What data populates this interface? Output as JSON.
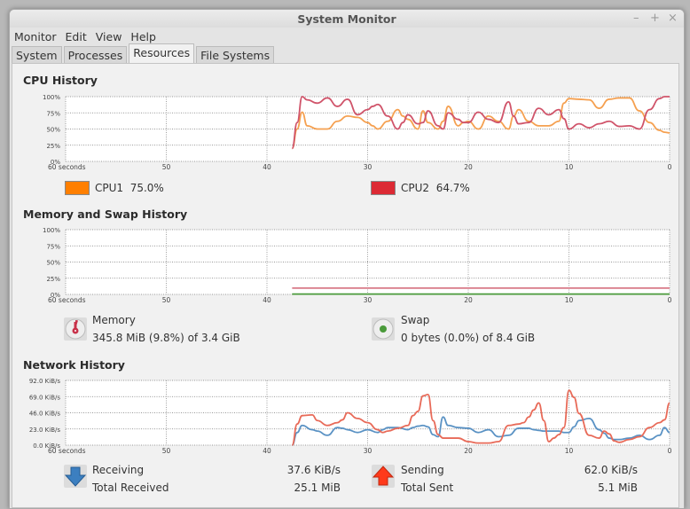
{
  "window": {
    "title": "System Monitor",
    "controls": {
      "minimize": "–",
      "maximize": "+",
      "close": "×"
    }
  },
  "menubar": {
    "items": [
      "Monitor",
      "Edit",
      "View",
      "Help"
    ]
  },
  "tabs": [
    {
      "label": "System",
      "active": false
    },
    {
      "label": "Processes",
      "active": false
    },
    {
      "label": "Resources",
      "active": true
    },
    {
      "label": "File Systems",
      "active": false
    }
  ],
  "cpu": {
    "title": "CPU History",
    "legend": [
      {
        "name": "CPU1",
        "value": "75.0%",
        "color": "#ff7f00"
      },
      {
        "name": "CPU2",
        "value": "64.7%",
        "color": "#dc2a34"
      }
    ]
  },
  "memory": {
    "title": "Memory and Swap History",
    "memory_label": "Memory",
    "memory_value": "345.8 MiB (9.8%) of 3.4 GiB",
    "swap_label": "Swap",
    "swap_value": "0 bytes (0.0%) of 8.4 GiB",
    "memory_color": "#c8324a",
    "swap_color": "#4a9a3a"
  },
  "network": {
    "title": "Network History",
    "receiving_label": "Receiving",
    "receiving_value": "37.6 KiB/s",
    "total_received_label": "Total Received",
    "total_received_value": "25.1 MiB",
    "sending_label": "Sending",
    "sending_value": "62.0 KiB/s",
    "total_sent_label": "Total Sent",
    "total_sent_value": "5.1 MiB",
    "receiving_color": "#3c7fc0",
    "sending_color": "#e04a32"
  },
  "chart_data": [
    {
      "type": "line",
      "title": "CPU History",
      "xlabel": "seconds",
      "x_ticks": [
        "60 seconds",
        "50",
        "40",
        "30",
        "20",
        "10",
        "0"
      ],
      "y_ticks": [
        "100%",
        "75%",
        "50%",
        "25%",
        "0%"
      ],
      "xlim": [
        60,
        0
      ],
      "ylim": [
        0,
        100
      ],
      "grid": true,
      "x": [
        37.5,
        37,
        36.5,
        36,
        35,
        34,
        33,
        32,
        31,
        30,
        29.5,
        29,
        28,
        27,
        26.5,
        26,
        25,
        24.5,
        24,
        23,
        22.5,
        22,
        21,
        20.5,
        20,
        19,
        18,
        17,
        16,
        15.5,
        15,
        14,
        13,
        12,
        11,
        10.5,
        10,
        9,
        8,
        7,
        6,
        5,
        4,
        3,
        2,
        1,
        0.5,
        0
      ],
      "series": [
        {
          "name": "CPU1",
          "color": "#f5a050",
          "values": [
            20,
            50,
            76,
            55,
            50,
            50,
            62,
            70,
            68,
            60,
            55,
            50,
            62,
            80,
            70,
            65,
            50,
            78,
            60,
            50,
            62,
            85,
            55,
            60,
            62,
            50,
            70,
            62,
            50,
            70,
            80,
            62,
            55,
            55,
            62,
            90,
            97,
            96,
            95,
            82,
            96,
            98,
            98,
            78,
            60,
            48,
            45,
            44
          ]
        },
        {
          "name": "CPU2",
          "color": "#d0546a",
          "values": [
            20,
            60,
            100,
            95,
            90,
            98,
            85,
            96,
            72,
            80,
            85,
            88,
            70,
            50,
            60,
            72,
            58,
            60,
            78,
            55,
            50,
            75,
            65,
            60,
            60,
            76,
            65,
            60,
            92,
            70,
            58,
            60,
            82,
            72,
            80,
            66,
            50,
            58,
            52,
            58,
            62,
            54,
            55,
            50,
            80,
            97,
            100,
            100
          ]
        }
      ]
    },
    {
      "type": "line",
      "title": "Memory and Swap History",
      "xlabel": "seconds",
      "x_ticks": [
        "60 seconds",
        "50",
        "40",
        "30",
        "20",
        "10",
        "0"
      ],
      "y_ticks": [
        "100%",
        "75%",
        "50%",
        "25%",
        "0%"
      ],
      "xlim": [
        60,
        0
      ],
      "ylim": [
        0,
        100
      ],
      "grid": true,
      "x": [
        37.5,
        0
      ],
      "series": [
        {
          "name": "Memory",
          "color": "#d87a88",
          "values": [
            9.8,
            9.8
          ]
        },
        {
          "name": "Swap",
          "color": "#4a9a3a",
          "values": [
            0.5,
            0.5
          ]
        }
      ]
    },
    {
      "type": "line",
      "title": "Network History",
      "xlabel": "seconds",
      "x_ticks": [
        "60 seconds",
        "50",
        "40",
        "30",
        "20",
        "10",
        "0"
      ],
      "y_ticks": [
        "92.0 KiB/s",
        "69.0 KiB/s",
        "46.0 KiB/s",
        "23.0 KiB/s",
        "0.0 KiB/s"
      ],
      "xlim": [
        60,
        0
      ],
      "ylim": [
        0,
        92
      ],
      "grid": true,
      "x": [
        37.5,
        37,
        36.5,
        35.5,
        35,
        34,
        33,
        32.5,
        32,
        31,
        30,
        29,
        28.5,
        28,
        27,
        26,
        25.5,
        25,
        24.5,
        24,
        23.5,
        23,
        22.5,
        22,
        21,
        20,
        19,
        18,
        17,
        16,
        15,
        14.5,
        14,
        13.5,
        13,
        12.5,
        12,
        11.5,
        11,
        10.5,
        10,
        9.5,
        9,
        8,
        7,
        6.5,
        6,
        5.5,
        5,
        4,
        3,
        2,
        1,
        0.5,
        0
      ],
      "series": [
        {
          "name": "Receiving",
          "color": "#5a92c4",
          "values": [
            0,
            18,
            28,
            22,
            20,
            14,
            25,
            24,
            22,
            18,
            22,
            18,
            22,
            25,
            25,
            22,
            25,
            27,
            28,
            26,
            15,
            12,
            40,
            28,
            25,
            24,
            18,
            22,
            12,
            14,
            24,
            24,
            24,
            22,
            21,
            20,
            20,
            20,
            20,
            18,
            18,
            26,
            35,
            38,
            22,
            17,
            10,
            8,
            8,
            10,
            14,
            8,
            14,
            25,
            18
          ]
        },
        {
          "name": "Sending",
          "color": "#e86a58",
          "values": [
            0,
            30,
            42,
            43,
            35,
            28,
            32,
            36,
            46,
            38,
            32,
            22,
            18,
            20,
            24,
            28,
            42,
            48,
            70,
            72,
            35,
            15,
            10,
            10,
            10,
            5,
            3,
            3,
            5,
            28,
            30,
            32,
            40,
            50,
            60,
            35,
            5,
            10,
            15,
            25,
            78,
            68,
            45,
            14,
            10,
            20,
            16,
            6,
            4,
            8,
            12,
            25,
            32,
            36,
            60
          ]
        }
      ]
    }
  ]
}
